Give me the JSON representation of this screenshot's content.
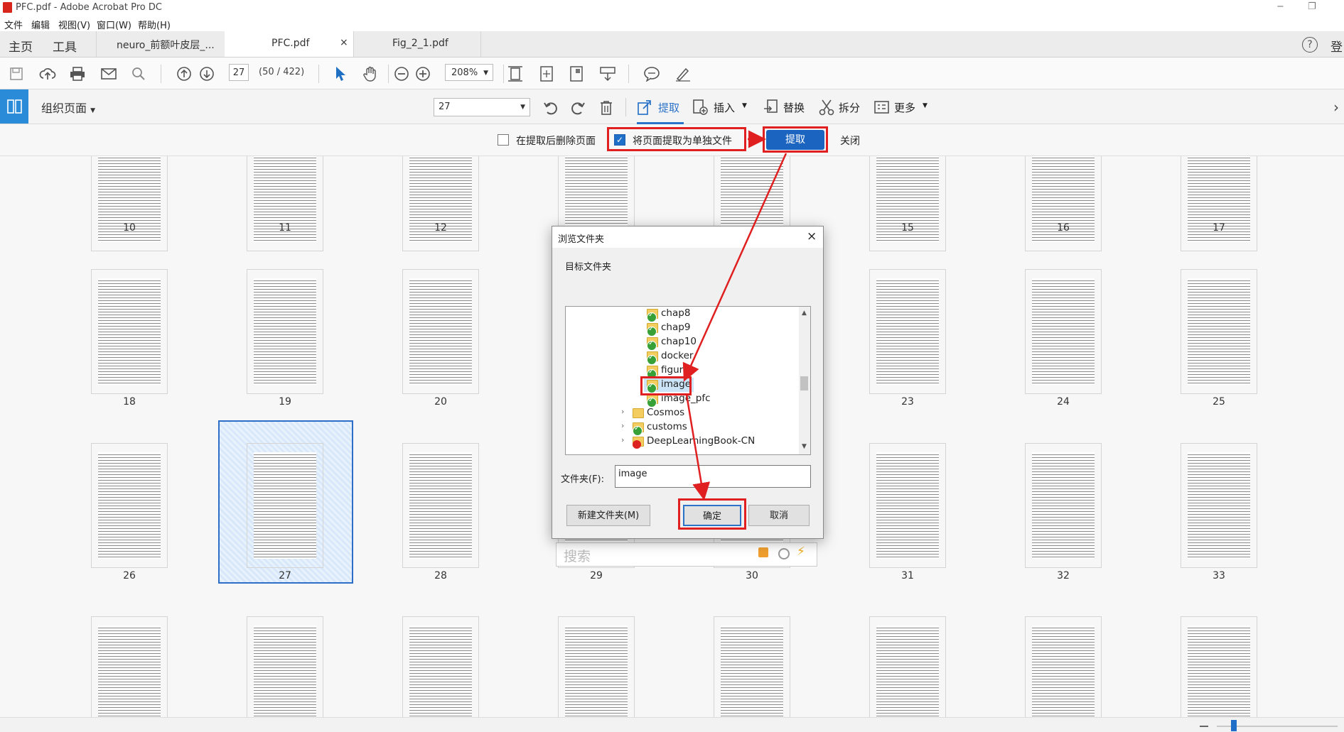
{
  "window": {
    "title": "PFC.pdf - Adobe Acrobat Pro DC",
    "minimize": "−",
    "restore": "❐"
  },
  "menu": [
    "文件",
    "编辑",
    "视图(V)",
    "窗口(W)",
    "帮助(H)"
  ],
  "nav": {
    "home": "主页",
    "tools": "工具",
    "help": "?",
    "signin": "登"
  },
  "tabs": [
    {
      "label": "neuro_前额叶皮层_..."
    },
    {
      "label": "PFC.pdf",
      "close": "×"
    },
    {
      "label": "Fig_2_1.pdf"
    }
  ],
  "toolbar": {
    "page_current": "27",
    "page_count": "(50 / 422)",
    "zoom": "208%"
  },
  "organize": {
    "title": "组织页面",
    "page_range": "27",
    "extract": "提取",
    "insert": "插入",
    "replace": "替换",
    "split": "拆分",
    "more": "更多"
  },
  "extract_bar": {
    "delete_after": "在提取后删除页面",
    "separate_files": "将页面提取为单独文件",
    "extract_button": "提取",
    "close": "关闭"
  },
  "page_numbers": {
    "row1": [
      "10",
      "11",
      "12",
      "15",
      "16",
      "17"
    ],
    "row2": [
      "18",
      "19",
      "20",
      "23",
      "24",
      "25"
    ],
    "row3": [
      "26",
      "27",
      "28",
      "29",
      "30",
      "31",
      "32",
      "33"
    ]
  },
  "dialog": {
    "title": "浏览文件夹",
    "close": "×",
    "target_label": "目标文件夹",
    "tree": [
      "chap8",
      "chap9",
      "chap10",
      "docker",
      "figure",
      "image",
      "image_pfc",
      "Cosmos",
      "customs",
      "DeepLearningBook-CN"
    ],
    "folder_label": "文件夹(F):",
    "folder_value": "image",
    "new_folder": "新建文件夹(M)",
    "ok": "确定",
    "cancel": "取消"
  },
  "search": {
    "placeholder": "搜索"
  }
}
